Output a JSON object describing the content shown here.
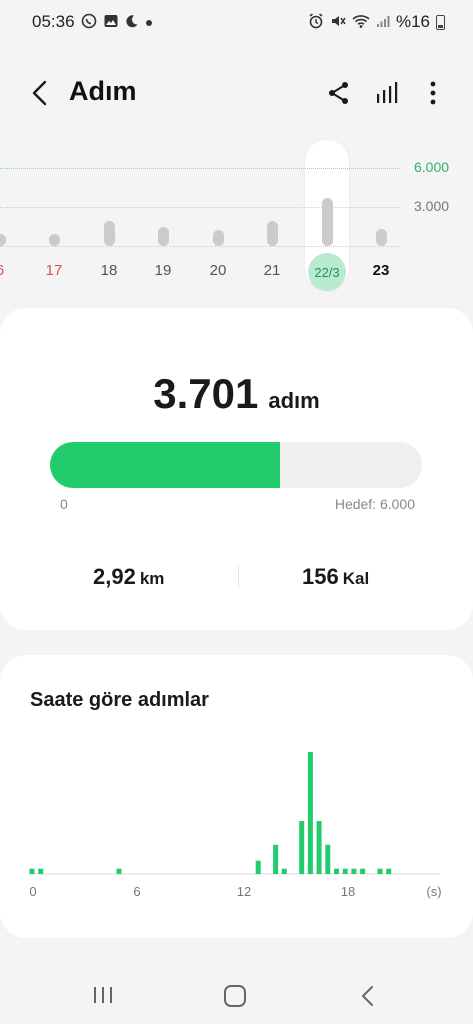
{
  "status_bar": {
    "time": "05:36",
    "battery": "%16",
    "left_icons": [
      "whatsapp-icon",
      "gallery-icon",
      "moon-icon",
      "dot-icon"
    ],
    "right_icons": [
      "alarm-icon",
      "mute-icon",
      "wifi-icon",
      "signal-icon",
      "battery-icon"
    ]
  },
  "header": {
    "title": "Adım"
  },
  "daily_chart": {
    "gridlines": {
      "top_label": "6.000",
      "mid_label": "3.000"
    },
    "days": [
      {
        "label": "6",
        "style": "red",
        "steps": 900
      },
      {
        "label": "17",
        "style": "red",
        "steps": 900
      },
      {
        "label": "18",
        "style": "normal",
        "steps": 1900
      },
      {
        "label": "19",
        "style": "normal",
        "steps": 1500
      },
      {
        "label": "20",
        "style": "normal",
        "steps": 1200
      },
      {
        "label": "21",
        "style": "normal",
        "steps": 1900
      },
      {
        "label": "22/3",
        "style": "selected",
        "steps": 3701
      },
      {
        "label": "23",
        "style": "bold",
        "steps": 1300
      }
    ]
  },
  "summary": {
    "steps": "3.701",
    "steps_unit": "adım",
    "progress_fraction": 0.617,
    "progress_min_label": "0",
    "goal_label": "Hedef: 6.000",
    "distance_value": "2,92",
    "distance_unit": "km",
    "calories_value": "156",
    "calories_unit": "Kal"
  },
  "hourly": {
    "title": "Saate göre adımlar",
    "axis_labels": [
      "0",
      "6",
      "12",
      "18",
      "(s)"
    ]
  },
  "colors": {
    "accent_green": "#22cc6c",
    "selected_circle": "#b9ead0",
    "weekend_red": "#d9534f"
  },
  "chart_data": {
    "type": "bar",
    "title": "Saate göre adımlar",
    "xlabel": "(s)",
    "x_ticks": [
      0,
      6,
      12,
      18
    ],
    "x": [
      0,
      0.5,
      5,
      13,
      14,
      14.5,
      15.5,
      16,
      16.5,
      17,
      17.5,
      18,
      18.5,
      19,
      20,
      20.5
    ],
    "values": [
      20,
      20,
      20,
      50,
      110,
      20,
      200,
      460,
      200,
      110,
      20,
      20,
      20,
      20,
      20,
      20
    ]
  }
}
